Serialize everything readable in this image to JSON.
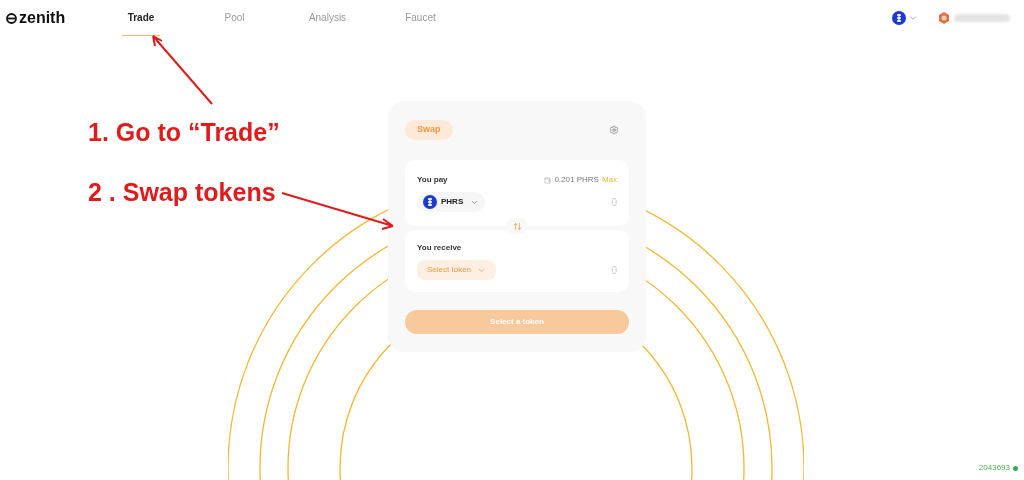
{
  "header": {
    "logo": "zenith",
    "nav": [
      {
        "label": "Trade",
        "selected": true
      },
      {
        "label": "Pool",
        "selected": false
      },
      {
        "label": "Analysis",
        "selected": false
      },
      {
        "label": "Faucet",
        "selected": false
      }
    ]
  },
  "swap": {
    "tab": "Swap",
    "pay": {
      "label": "You pay",
      "balance": "0.201 PHRS",
      "max": "Max",
      "token": "PHRS",
      "amount": "0"
    },
    "receive": {
      "label": "You receive",
      "token": "Select token",
      "amount": "0"
    },
    "action": {
      "label": "Select a token",
      "disabled": true
    }
  },
  "annotations": [
    "1. Go to “Trade”",
    "2 . Swap tokens"
  ],
  "status": {
    "block": "2043693"
  }
}
